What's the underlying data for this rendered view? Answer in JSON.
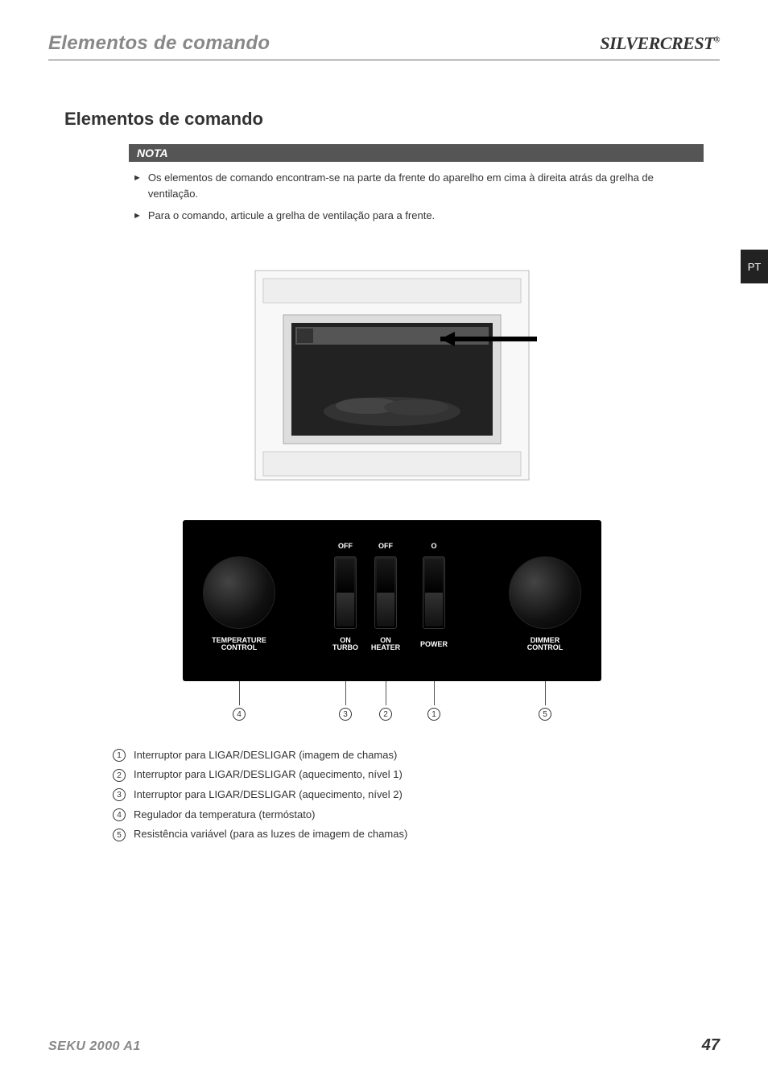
{
  "header": {
    "title": "Elementos de comando",
    "brand": "SILVERCREST",
    "brand_reg": "®"
  },
  "side_tab": "PT",
  "section_title": "Elementos de comando",
  "note": {
    "label": "NOTA",
    "items": [
      "Os elementos de comando encontram-se na parte da frente do aparelho em cima à direita atrás da grelha de ventilação.",
      "Para o comando, articule a grelha de ventilação para a frente."
    ]
  },
  "panel": {
    "off1": "OFF",
    "off2": "OFF",
    "o": "O",
    "temp1": "TEMPERATURE",
    "temp2": "CONTROL",
    "turbo1": "ON",
    "turbo2": "TURBO",
    "heater1": "ON",
    "heater2": "HEATER",
    "power": "POWER",
    "dimmer1": "DIMMER",
    "dimmer2": "CONTROL"
  },
  "callouts": {
    "c1": "1",
    "c2": "2",
    "c3": "3",
    "c4": "4",
    "c5": "5"
  },
  "legend": [
    {
      "num": "1",
      "text": "Interruptor para LIGAR/DESLIGAR (imagem de chamas)"
    },
    {
      "num": "2",
      "text": "Interruptor para LIGAR/DESLIGAR (aquecimento, nível 1)"
    },
    {
      "num": "3",
      "text": "Interruptor para LIGAR/DESLIGAR (aquecimento, nível 2)"
    },
    {
      "num": "4",
      "text": "Regulador da temperatura (termóstato)"
    },
    {
      "num": "5",
      "text": "Resistência variável (para as luzes de imagem de chamas)"
    }
  ],
  "footer": {
    "model": "SEKU 2000 A1",
    "page": "47"
  }
}
